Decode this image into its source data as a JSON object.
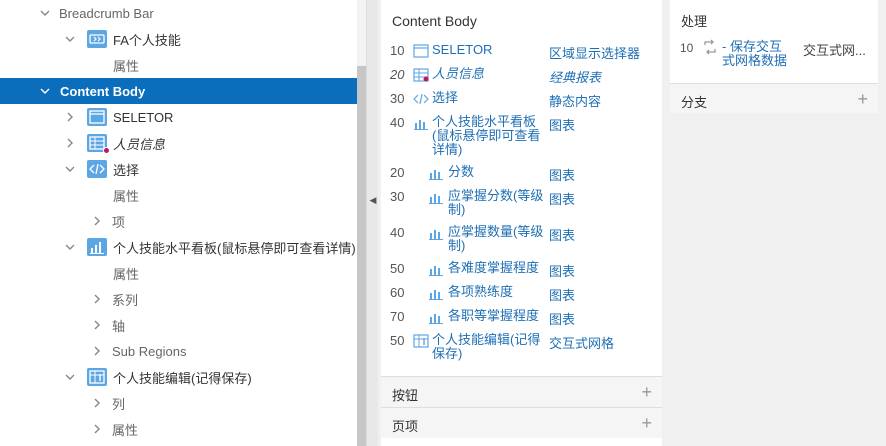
{
  "tree": {
    "rows": [
      {
        "label": "Breadcrumb Bar",
        "toggle": "down",
        "icon": null,
        "level": 0
      },
      {
        "label": "FA个人技能",
        "toggle": "down",
        "icon": "breadcrumb-region-icon",
        "level": 1
      },
      {
        "label": "属性",
        "toggle": null,
        "icon": null,
        "level": 2
      },
      {
        "label": "Content Body",
        "toggle": "down",
        "icon": null,
        "level": 0,
        "selected": true
      },
      {
        "label": "SELETOR",
        "toggle": "right",
        "icon": "static-region-icon",
        "level": 1
      },
      {
        "label": "人员信息",
        "toggle": "right",
        "icon": "classic-report-icon",
        "level": 1,
        "italic": true
      },
      {
        "label": "选择",
        "toggle": "down",
        "icon": "static-content-icon",
        "level": 1
      },
      {
        "label": "属性",
        "toggle": null,
        "icon": null,
        "level": 2
      },
      {
        "label": "项",
        "toggle": "right",
        "icon": null,
        "level": 2
      },
      {
        "label": "个人技能水平看板(鼠标悬停即可查看详情)",
        "toggle": "down",
        "icon": "chart-icon",
        "level": 1
      },
      {
        "label": "属性",
        "toggle": null,
        "icon": null,
        "level": 2
      },
      {
        "label": "系列",
        "toggle": "right",
        "icon": null,
        "level": 2
      },
      {
        "label": "轴",
        "toggle": "right",
        "icon": null,
        "level": 2
      },
      {
        "label": "Sub Regions",
        "toggle": "right",
        "icon": null,
        "level": 2
      },
      {
        "label": "个人技能编辑(记得保存)",
        "toggle": "down",
        "icon": "interactive-grid-icon",
        "level": 1
      },
      {
        "label": "列",
        "toggle": "right",
        "icon": null,
        "level": 2
      },
      {
        "label": "属性",
        "toggle": "right",
        "icon": null,
        "level": 2
      }
    ]
  },
  "middle": {
    "title": "Content Body",
    "rows": [
      {
        "seq": "10",
        "name": "SELETOR",
        "type": "区域显示选择器",
        "icon": "static-region-icon"
      },
      {
        "seq": "20",
        "name": "人员信息",
        "type": "经典报表",
        "icon": "classic-report-icon",
        "italic": true
      },
      {
        "seq": "30",
        "name": "选择",
        "type": "静态内容",
        "icon": "static-content-icon"
      },
      {
        "seq": "40",
        "name": "个人技能水平看板(鼠标悬停即可查看详情)",
        "type": "图表",
        "icon": "chart-icon"
      },
      {
        "seq": "20",
        "name": "分数",
        "type": "图表",
        "icon": "chart-icon",
        "sub": true
      },
      {
        "seq": "30",
        "name": "应掌握分数(等级制)",
        "type": "图表",
        "icon": "chart-icon",
        "sub": true
      },
      {
        "seq": "40",
        "name": "应掌握数量(等级制)",
        "type": "图表",
        "icon": "chart-icon",
        "sub": true
      },
      {
        "seq": "50",
        "name": "各难度掌握程度",
        "type": "图表",
        "icon": "chart-icon",
        "sub": true
      },
      {
        "seq": "60",
        "name": "各项熟练度",
        "type": "图表",
        "icon": "chart-icon",
        "sub": true
      },
      {
        "seq": "70",
        "name": "各职等掌握程度",
        "type": "图表",
        "icon": "chart-icon",
        "sub": true
      },
      {
        "seq": "50",
        "name": "个人技能编辑(记得保存)",
        "type": "交互式网格",
        "icon": "interactive-grid-icon"
      }
    ],
    "sections": [
      {
        "title": "按钮"
      },
      {
        "title": "页项"
      }
    ]
  },
  "right": {
    "title": "处理",
    "process": {
      "seq": "10",
      "name": "- 保存交互式网格数据",
      "type": "交互式网..."
    },
    "branch": {
      "title": "分支"
    }
  },
  "colors": {
    "accent": "#0a6ebd",
    "link": "#1f6fb5",
    "icon": "#5da6e4"
  }
}
